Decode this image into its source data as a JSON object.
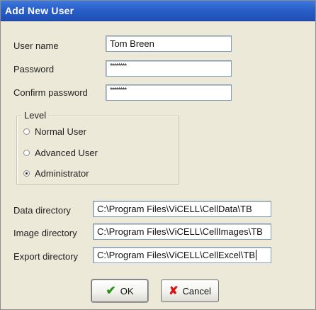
{
  "window": {
    "title": "Add New User"
  },
  "fields": {
    "username_label": "User name",
    "username_value": "Tom Breen",
    "password_label": "Password",
    "password_value": "********",
    "confirm_label": "Confirm password",
    "confirm_value": "********"
  },
  "level": {
    "legend": "Level",
    "options": [
      "Normal User",
      "Advanced User",
      "Administrator"
    ],
    "selected": "Administrator"
  },
  "directories": {
    "data_label": "Data directory",
    "data_value": "C:\\Program Files\\ViCELL\\CellData\\TB",
    "image_label": "Image directory",
    "image_value": "C:\\Program Files\\ViCELL\\CellImages\\TB",
    "export_label": "Export directory",
    "export_value": "C:\\Program Files\\ViCELL\\CellExcel\\TB"
  },
  "buttons": {
    "ok": "OK",
    "cancel": "Cancel"
  },
  "icons": {
    "ok": "checkmark-icon",
    "cancel": "x-icon"
  },
  "colors": {
    "titlebar": "#2a5fc9",
    "dialog_bg": "#ece9d8",
    "ok_icon": "#2f8f1f",
    "cancel_icon": "#d01818"
  }
}
